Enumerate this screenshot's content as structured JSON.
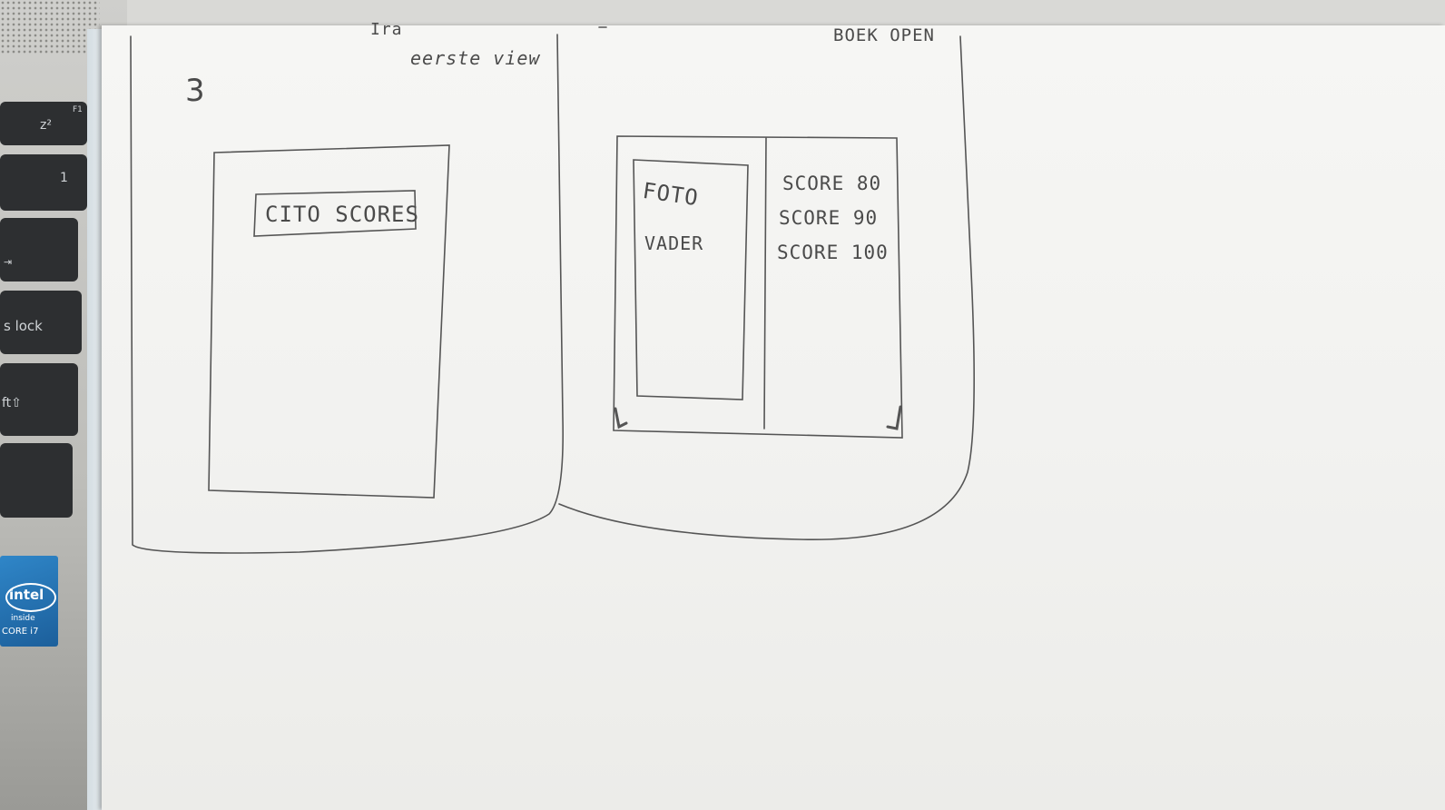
{
  "laptop": {
    "keys": [
      {
        "label": "z²",
        "fn": "F1"
      },
      {
        "label": "1",
        "fn": ""
      },
      {
        "label": "⇥",
        "fn": ""
      },
      {
        "label": "s lock",
        "fn": ""
      },
      {
        "label": "ft⇧",
        "fn": ""
      }
    ],
    "sticker": {
      "brand": "intel",
      "line1": "inside",
      "line2": "CORE i7"
    }
  },
  "sketch": {
    "top_mark": "Ira",
    "page_number": "3",
    "left_panel": {
      "caption": "eerste view",
      "button_label": "CITO SCORES"
    },
    "right_panel": {
      "caption": "BOEK OPEN",
      "photo_line1": "FOTO",
      "photo_line2": "VADER",
      "scores": [
        "SCORE 80",
        "SCORE 90",
        "SCORE 100"
      ]
    }
  }
}
